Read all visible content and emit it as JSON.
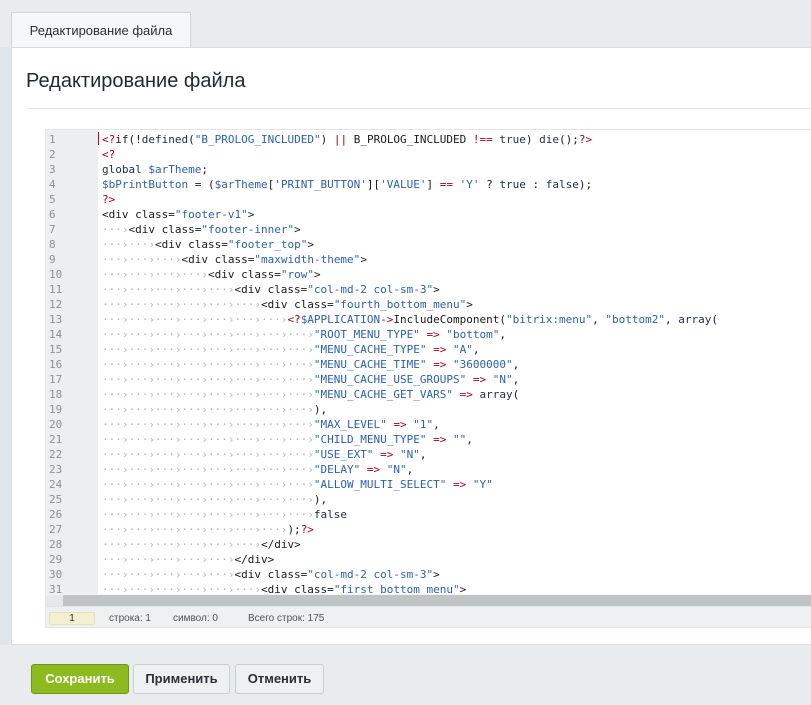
{
  "tab": {
    "label": "Редактирование файла"
  },
  "panel": {
    "title": "Редактирование файла"
  },
  "editor": {
    "lines": [
      "<?if(!defined(\"B_PROLOG_INCLUDED\") || B_PROLOG_INCLUDED !== true) die();?>",
      "<?",
      "global $arTheme;",
      "$bPrintButton = ($arTheme['PRINT_BUTTON']['VALUE'] == 'Y' ? true : false);",
      "?>",
      "<div class=\"footer-v1\">",
      "\t<div class=\"footer-inner\">",
      "\t\t<div class=\"footer_top\">",
      "\t\t\t<div class=\"maxwidth-theme\">",
      "\t\t\t\t<div class=\"row\">",
      "\t\t\t\t\t<div class=\"col-md-2 col-sm-3\">",
      "\t\t\t\t\t\t<div class=\"fourth_bottom_menu\">",
      "\t\t\t\t\t\t\t<?$APPLICATION->IncludeComponent(\"bitrix:menu\", \"bottom2\", array(",
      "\t\t\t\t\t\t\t\t\"ROOT_MENU_TYPE\" => \"bottom\",",
      "\t\t\t\t\t\t\t\t\"MENU_CACHE_TYPE\" => \"A\",",
      "\t\t\t\t\t\t\t\t\"MENU_CACHE_TIME\" => \"3600000\",",
      "\t\t\t\t\t\t\t\t\"MENU_CACHE_USE_GROUPS\" => \"N\",",
      "\t\t\t\t\t\t\t\t\"MENU_CACHE_GET_VARS\" => array(",
      "\t\t\t\t\t\t\t\t),",
      "\t\t\t\t\t\t\t\t\"MAX_LEVEL\" => \"1\",",
      "\t\t\t\t\t\t\t\t\"CHILD_MENU_TYPE\" => \"\",",
      "\t\t\t\t\t\t\t\t\"USE_EXT\" => \"N\",",
      "\t\t\t\t\t\t\t\t\"DELAY\" => \"N\",",
      "\t\t\t\t\t\t\t\t\"ALLOW_MULTI_SELECT\" => \"Y\"",
      "\t\t\t\t\t\t\t\t),",
      "\t\t\t\t\t\t\t\tfalse",
      "\t\t\t\t\t\t\t);?>",
      "\t\t\t\t\t\t</div>",
      "\t\t\t\t\t</div>",
      "\t\t\t\t\t<div class=\"col-md-2 col-sm-3\">",
      "\t\t\t\t\t\t<div class=\"first_bottom_menu\">"
    ]
  },
  "status": {
    "current_line": "1",
    "position": "строка: 1",
    "symbol": "символ: 0",
    "total": "Всего строк: 175"
  },
  "buttons": {
    "save": "Сохранить",
    "apply": "Применить",
    "cancel": "Отменить"
  },
  "colors": {
    "accent": "#8dbb1f"
  }
}
